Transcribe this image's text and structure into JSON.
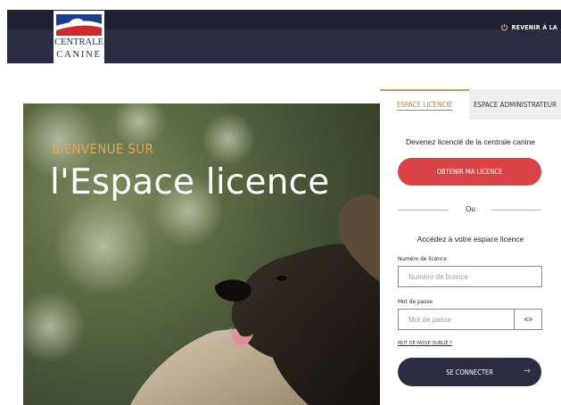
{
  "header": {
    "back_link_label": "REVENIR À LA",
    "back_icon": "power-icon",
    "logo": {
      "line1": "CENTRALE",
      "line2": "CANINE"
    }
  },
  "hero": {
    "kicker": "BIENVENUE SUR",
    "title": "l'Espace licence"
  },
  "panel": {
    "tabs": [
      {
        "label": "ESPACE LICENCIÉ",
        "active": true
      },
      {
        "label": "ESPACE ADMINISTRATEUR",
        "active": false
      }
    ],
    "become_text": "Devenez licencié de la centrale canine",
    "get_licence_button": "OBTENIR MA LICENCE",
    "separator_text": "Ou",
    "access_text": "Accédez à votre espace licence",
    "licence_number": {
      "label": "Numéro de licence",
      "placeholder": "Numéro de licence",
      "value": ""
    },
    "password": {
      "label": "Mot de passe",
      "placeholder": "Mot de passe",
      "value": ""
    },
    "eye_icon": "eye-icon",
    "forgot_link": "MOT DE PASSE OUBLIÉ ?",
    "connect_button": "SE CONNECTER",
    "connect_icon": "arrow-right-icon"
  },
  "colors": {
    "header_bg": "#2a2c41",
    "accent_gold": "#c79a5d",
    "licence_red": "#d94346",
    "connect_navy": "#2a2c41"
  }
}
